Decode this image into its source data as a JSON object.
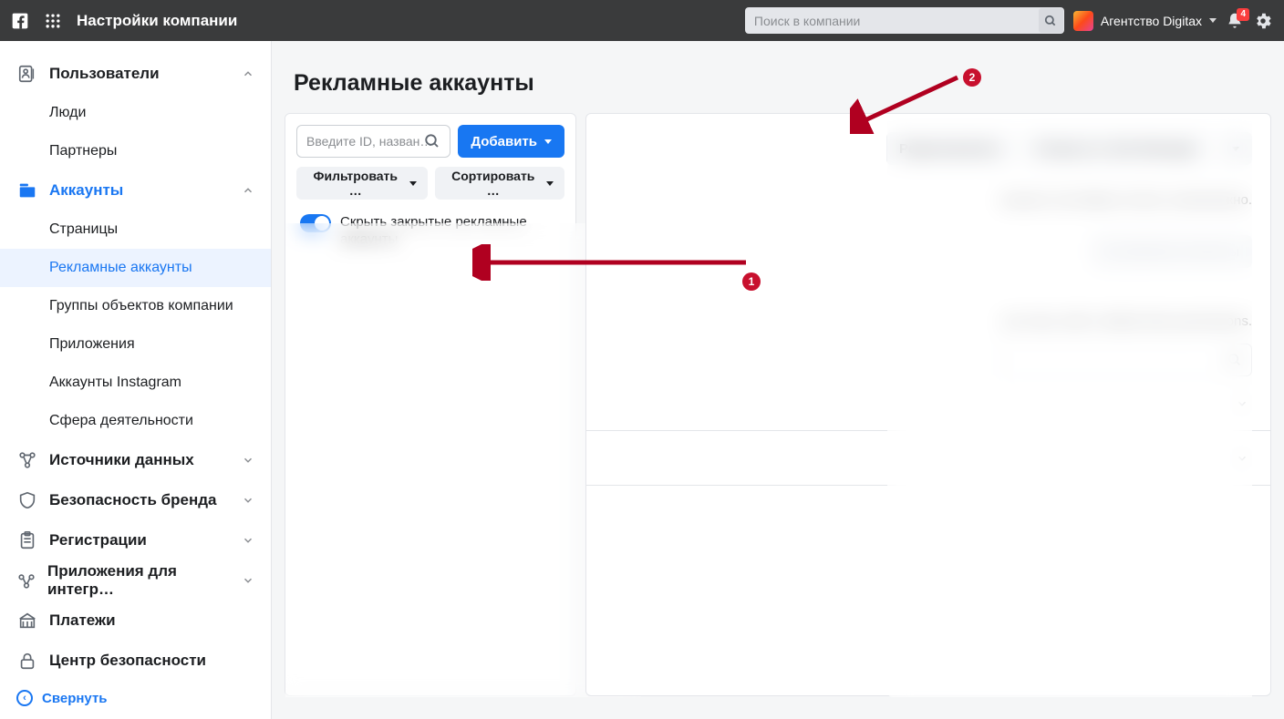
{
  "topbar": {
    "title": "Настройки компании",
    "search_placeholder": "Поиск в компании",
    "agency_name": "Агентство Digitax",
    "notification_count": "4"
  },
  "sidebar": {
    "users": {
      "label": "Пользователи",
      "sub": {
        "people": "Люди",
        "partners": "Партнеры"
      }
    },
    "accounts": {
      "label": "Аккаунты",
      "sub": {
        "pages": "Страницы",
        "ad_accounts": "Рекламные аккаунты",
        "business_asset_groups": "Группы объектов компании",
        "apps": "Приложения",
        "instagram": "Аккаунты Instagram",
        "business_lines": "Сфера деятельности"
      }
    },
    "data_sources": "Источники данных",
    "brand_safety": "Безопасность бренда",
    "registrations": "Регистрации",
    "integrations": "Приложения для интегр…",
    "payments": "Платежи",
    "security_center": "Центр безопасности",
    "collapse": "Свернуть"
  },
  "content": {
    "page_title": "Рекламные аккаунты",
    "left_panel": {
      "search_placeholder": "Введите ID, назван…",
      "add_button": "Добавить",
      "filter_button": "Фильтровать …",
      "sort_button": "Сортировать …",
      "hide_closed_toggle": "Скрыть закрытые рекламные аккаунты"
    },
    "right_pane": {
      "edit_button": "Редактировать",
      "open_ads_manager_button": "Открыть в Ads Manager",
      "payment_note_tail": "емыми способами оплаты невозможно.",
      "add_objects": "Добавить объекты",
      "permissions_tail": "can view, edit or delete their permissions."
    }
  },
  "annotations": {
    "badge1": "1",
    "badge2": "2"
  }
}
